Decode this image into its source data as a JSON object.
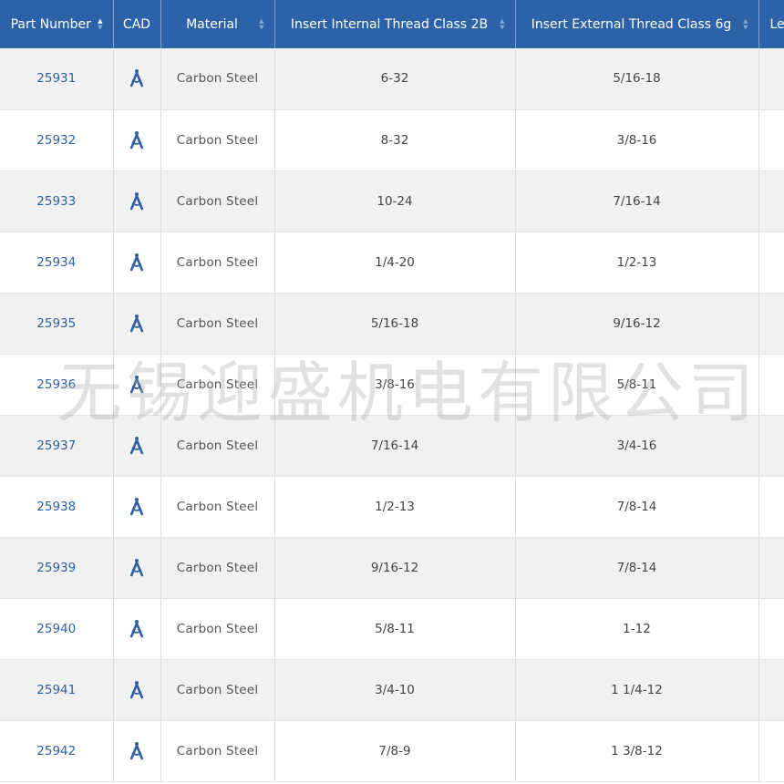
{
  "columns": {
    "part_number": "Part Number",
    "cad": "CAD",
    "material": "Material",
    "internal_thread": "Insert Internal Thread Class 2B",
    "external_thread": "Insert External Thread Class 6g",
    "length": "Le"
  },
  "sort_icons": {
    "up": "▲",
    "down": "▼"
  },
  "cad_icon": "compass-icon",
  "colors": {
    "header_bg": "#2c63a8",
    "header_text": "#ffffff",
    "link_blue": "#2d5fa0",
    "row_alt": "#f1f1f1",
    "cad_icon": "#2f5f9f"
  },
  "rows": [
    {
      "part": "25931",
      "material": "Carbon Steel",
      "internal": "6-32",
      "external": "5/16-18"
    },
    {
      "part": "25932",
      "material": "Carbon Steel",
      "internal": "8-32",
      "external": "3/8-16"
    },
    {
      "part": "25933",
      "material": "Carbon Steel",
      "internal": "10-24",
      "external": "7/16-14"
    },
    {
      "part": "25934",
      "material": "Carbon Steel",
      "internal": "1/4-20",
      "external": "1/2-13"
    },
    {
      "part": "25935",
      "material": "Carbon Steel",
      "internal": "5/16-18",
      "external": "9/16-12"
    },
    {
      "part": "25936",
      "material": "Carbon Steel",
      "internal": "3/8-16",
      "external": "5/8-11"
    },
    {
      "part": "25937",
      "material": "Carbon Steel",
      "internal": "7/16-14",
      "external": "3/4-16"
    },
    {
      "part": "25938",
      "material": "Carbon Steel",
      "internal": "1/2-13",
      "external": "7/8-14"
    },
    {
      "part": "25939",
      "material": "Carbon Steel",
      "internal": "9/16-12",
      "external": "7/8-14"
    },
    {
      "part": "25940",
      "material": "Carbon Steel",
      "internal": "5/8-11",
      "external": "1-12"
    },
    {
      "part": "25941",
      "material": "Carbon Steel",
      "internal": "3/4-10",
      "external": "1 1/4-12"
    },
    {
      "part": "25942",
      "material": "Carbon Steel",
      "internal": "7/8-9",
      "external": "1 3/8-12"
    }
  ],
  "watermark": "无锡迎盛机电有限公司"
}
